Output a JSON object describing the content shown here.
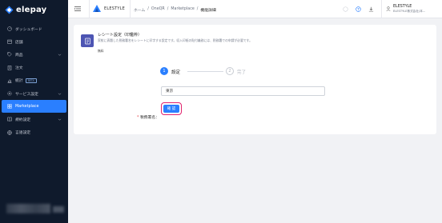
{
  "app": {
    "name": "elepay"
  },
  "sidebar": {
    "items": [
      {
        "label": "ダッシュボード",
        "icon": "dashboard-icon",
        "expandable": false,
        "active": false
      },
      {
        "label": "店舗",
        "icon": "store-icon",
        "expandable": false,
        "active": false
      },
      {
        "label": "商品",
        "icon": "tag-icon",
        "expandable": true,
        "active": false
      },
      {
        "label": "注文",
        "icon": "receipt-icon",
        "expandable": false,
        "active": false
      },
      {
        "label": "統計",
        "icon": "chart-icon",
        "expandable": false,
        "active": false,
        "badge": "BETA"
      },
      {
        "label": "サービス設定",
        "icon": "settings-icon",
        "expandable": true,
        "active": false
      },
      {
        "label": "Marketplace",
        "icon": "grid-icon",
        "expandable": false,
        "active": true
      },
      {
        "label": "規約設定",
        "icon": "book-icon",
        "expandable": true,
        "active": false
      },
      {
        "label": "言語設定",
        "icon": "globe-icon",
        "expandable": false,
        "active": false
      }
    ]
  },
  "header": {
    "brand": "ELESTYLE",
    "breadcrumb": [
      "ホーム",
      "OneQR",
      "Marketplace",
      "機能詳細"
    ],
    "user": {
      "name": "ELESTYLE",
      "sub": "ELESTYLE株式会社(本..."
    }
  },
  "card": {
    "title": "レシート設定（印鑑枠）",
    "description": "家紋に表題した税務署名をレシートに印字する設定です。収入印紙の貼付義務には、税務署での申請が必要です。",
    "price": "無料"
  },
  "steps": [
    {
      "number": "1",
      "label": "設定"
    },
    {
      "number": "2",
      "label": "完了"
    }
  ],
  "form": {
    "required_mark": "*",
    "label": "税務署名：",
    "value": "東京"
  },
  "confirm_label": "確 認",
  "colors": {
    "accent": "#2a7fff",
    "sidebar": "#0f1a2c",
    "highlight": "#e0226e",
    "icon_bg": "#4d55b3"
  }
}
